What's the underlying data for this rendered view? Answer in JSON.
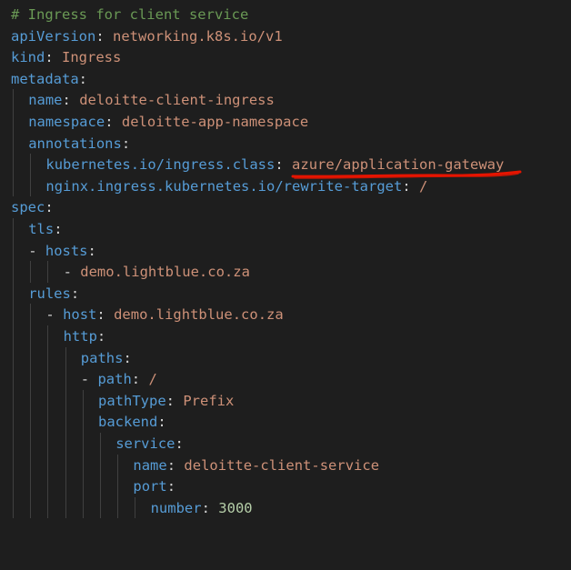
{
  "colors": {
    "background": "#1e1e1e",
    "comment": "#6a9955",
    "key": "#569cd6",
    "string": "#ce9178",
    "number": "#b5cea8",
    "punctuation": "#d4d4d4",
    "indent_guide": "#404040",
    "annotation_underline": "#e51400"
  },
  "lines": [
    {
      "indent": 0,
      "comment": "# Ingress for client service"
    },
    {
      "indent": 0,
      "key": "apiVersion",
      "value": "networking.k8s.io/v1"
    },
    {
      "indent": 0,
      "key": "kind",
      "value": "Ingress"
    },
    {
      "indent": 0,
      "key": "metadata",
      "value": ""
    },
    {
      "indent": 1,
      "key": "name",
      "value": "deloitte-client-ingress"
    },
    {
      "indent": 1,
      "key": "namespace",
      "value": "deloitte-app-namespace"
    },
    {
      "indent": 1,
      "key": "annotations",
      "value": ""
    },
    {
      "indent": 2,
      "key": "kubernetes.io/ingress.class",
      "value": "azure/application-gateway"
    },
    {
      "indent": 2,
      "key": "nginx.ingress.kubernetes.io/rewrite-target",
      "value": "/"
    },
    {
      "indent": 0,
      "key": "spec",
      "value": ""
    },
    {
      "indent": 1,
      "key": "tls",
      "value": ""
    },
    {
      "indent": 1,
      "dash": true,
      "key": "hosts",
      "value": ""
    },
    {
      "indent": 3,
      "dash": true,
      "value": "demo.lightblue.co.za"
    },
    {
      "indent": 1,
      "key": "rules",
      "value": ""
    },
    {
      "indent": 2,
      "dash": true,
      "key": "host",
      "value": "demo.lightblue.co.za"
    },
    {
      "indent": 3,
      "key": "http",
      "value": ""
    },
    {
      "indent": 4,
      "key": "paths",
      "value": ""
    },
    {
      "indent": 4,
      "dash": true,
      "key": "path",
      "value": "/"
    },
    {
      "indent": 5,
      "key": "pathType",
      "value": "Prefix"
    },
    {
      "indent": 5,
      "key": "backend",
      "value": ""
    },
    {
      "indent": 6,
      "key": "service",
      "value": ""
    },
    {
      "indent": 7,
      "key": "name",
      "value": "deloitte-client-service"
    },
    {
      "indent": 7,
      "key": "port",
      "value": ""
    },
    {
      "indent": 8,
      "key": "number",
      "value": "3000",
      "numeric": true
    },
    {
      "indent": 0,
      "blank": true
    },
    {
      "indent": 0,
      "blank": true
    },
    {
      "indent": 0,
      "separator": "---"
    }
  ]
}
